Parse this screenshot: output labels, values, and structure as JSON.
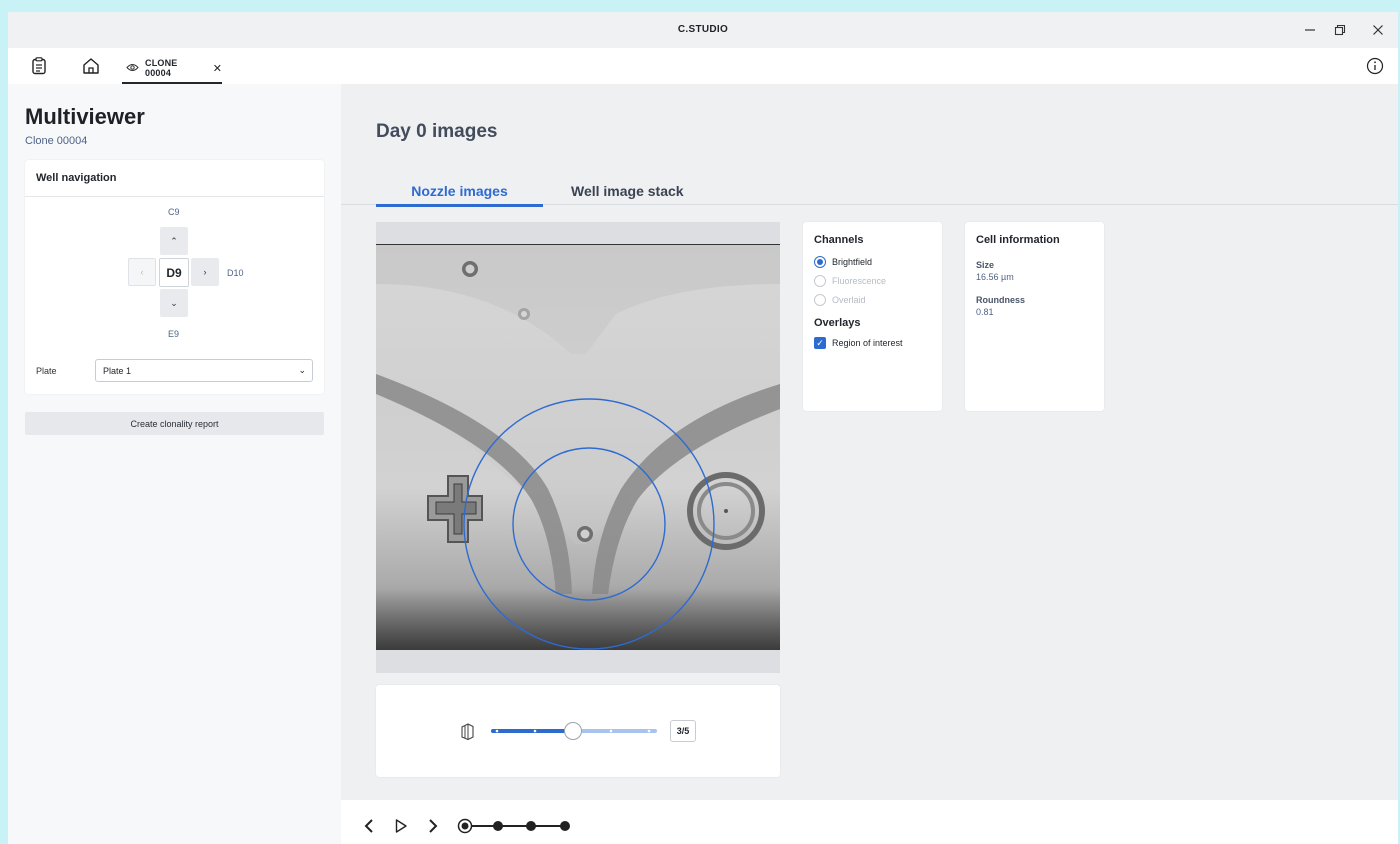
{
  "app": {
    "title": "C.STUDIO"
  },
  "tabbar": {
    "tab_label": "CLONE 00004",
    "tab_close": "✕"
  },
  "sidebar": {
    "title": "Multiviewer",
    "subtitle": "Clone 00004",
    "well_nav": {
      "header": "Well navigation",
      "current": "D9",
      "up": "C9",
      "down": "E9",
      "right": "D10",
      "up_arrow": "⌃",
      "down_arrow": "⌄",
      "left_arrow": "‹",
      "right_arrow": "›"
    },
    "plate": {
      "label": "Plate",
      "value": "Plate 1"
    },
    "report_button": "Create clonality report"
  },
  "main": {
    "heading": "Day 0 images",
    "tabs": [
      {
        "label": "Nozzle images",
        "active": true
      },
      {
        "label": "Well image stack",
        "active": false
      }
    ],
    "stack": {
      "position": 3,
      "total": 5,
      "counter": "3/5"
    }
  },
  "channels": {
    "title": "Channels",
    "options": [
      {
        "label": "Brightfield",
        "selected": true,
        "enabled": true
      },
      {
        "label": "Fluorescence",
        "selected": false,
        "enabled": false
      },
      {
        "label": "Overlaid",
        "selected": false,
        "enabled": false
      }
    ],
    "overlays_title": "Overlays",
    "overlays": [
      {
        "label": "Region of interest",
        "checked": true
      }
    ]
  },
  "cell_info": {
    "title": "Cell information",
    "size_label": "Size",
    "size_value": "16.56 µm",
    "roundness_label": "Roundness",
    "roundness_value": "0.81"
  },
  "timeline": {
    "steps": 4,
    "current": 1
  },
  "colors": {
    "accent": "#2d6bd1",
    "window_bg": "#f0f1f3",
    "backdrop": "#c9f2f6"
  }
}
